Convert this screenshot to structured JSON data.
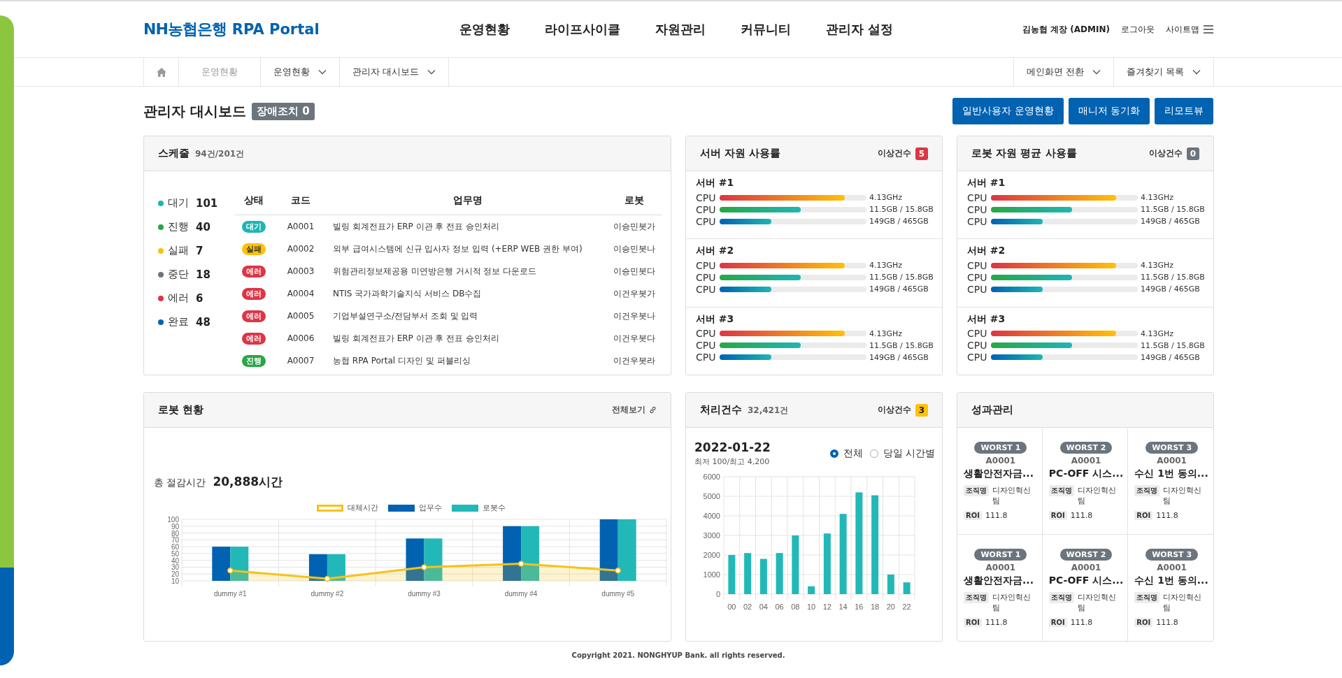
{
  "header": {
    "logo": {
      "brand": "NH농협은행",
      "product": "RPA Portal"
    },
    "menu": [
      "운영현황",
      "라이프사이클",
      "자원관리",
      "커뮤니티",
      "관리자 설정"
    ],
    "user": "김농협 계장 (ADMIN)",
    "logout": "로그아웃",
    "sitemap": "사이트맵"
  },
  "breadcrumb": {
    "current": "운영현황",
    "dropdowns": [
      "운영현황",
      "관리자 대시보드"
    ],
    "right_dropdowns": [
      "메인화면 전환",
      "즐겨찾기 목록"
    ]
  },
  "page": {
    "title": "관리자 대시보드",
    "badge": "장애조치 0",
    "buttons": [
      "일반사용자 운영현황",
      "매니저 동기화",
      "리모트뷰"
    ]
  },
  "schedule": {
    "title": "스케줄",
    "count": "94건/201건",
    "legend": [
      {
        "label": "대기",
        "count": "101",
        "color": "#1fb5b5"
      },
      {
        "label": "진행",
        "count": "40",
        "color": "#28a745"
      },
      {
        "label": "실패",
        "count": "7",
        "color": "#ffc107"
      },
      {
        "label": "중단",
        "count": "18",
        "color": "#6c757d"
      },
      {
        "label": "에러",
        "count": "6",
        "color": "#dc3545"
      },
      {
        "label": "완료",
        "count": "48",
        "color": "#0062b1"
      }
    ],
    "table": {
      "columns": [
        "상태",
        "코드",
        "업무명",
        "로봇"
      ],
      "rows": [
        {
          "status": {
            "label": "대기",
            "color": "#1fb5b5"
          },
          "code": "A0001",
          "task": "빌링 회계전표가 ERP 이관 후 전표 승인처리",
          "robot": "이승민봇가"
        },
        {
          "status": {
            "label": "실패",
            "color": "#ffc107"
          },
          "code": "A0002",
          "task": "외부 급여시스템에 신규 입사자 정보 입력 (+ERP WEB 권한 부여)",
          "robot": "이승민봇나"
        },
        {
          "status": {
            "label": "에러",
            "color": "#dc3545"
          },
          "code": "A0003",
          "task": "위험관리정보제공용 미연방은행 거시적 정보 다운로드",
          "robot": "이승민봇다"
        },
        {
          "status": {
            "label": "에러",
            "color": "#dc3545"
          },
          "code": "A0004",
          "task": "NTIS 국가과학기술지식 서비스 DB수집",
          "robot": "이건우봇가"
        },
        {
          "status": {
            "label": "에러",
            "color": "#dc3545"
          },
          "code": "A0005",
          "task": "기업부설연구소/전담부서 조회 및 입력",
          "robot": "이건우봇나"
        },
        {
          "status": {
            "label": "에러",
            "color": "#dc3545"
          },
          "code": "A0006",
          "task": "빌링 회계전표가 ERP 이관 후 전표 승인처리",
          "robot": "이건우봇다"
        },
        {
          "status": {
            "label": "진행",
            "color": "#28a745"
          },
          "code": "A0007",
          "task": "농협 RPA Portal 디자인 및 퍼블리싱",
          "robot": "이건우봇라"
        }
      ]
    }
  },
  "server_usage": {
    "title": "서버 자원 사용률",
    "alert": {
      "label": "이상건수",
      "count": "5",
      "kind": "danger"
    },
    "servers": [
      {
        "name": "서버 #1",
        "bars": [
          {
            "label": "CPU",
            "level": 0.85,
            "reading": "4.13GHz"
          },
          {
            "label": "CPU",
            "level": 0.55,
            "reading": "11.5GB / 15.8GB"
          },
          {
            "label": "CPU",
            "level": 0.35,
            "reading": "149GB / 465GB"
          }
        ]
      },
      {
        "name": "서버 #2",
        "bars": [
          {
            "label": "CPU",
            "level": 0.85,
            "reading": "4.13GHz"
          },
          {
            "label": "CPU",
            "level": 0.55,
            "reading": "11.5GB / 15.8GB"
          },
          {
            "label": "CPU",
            "level": 0.35,
            "reading": "149GB / 465GB"
          }
        ]
      },
      {
        "name": "서버 #3",
        "bars": [
          {
            "label": "CPU",
            "level": 0.85,
            "reading": "4.13GHz"
          },
          {
            "label": "CPU",
            "level": 0.55,
            "reading": "11.5GB / 15.8GB"
          },
          {
            "label": "CPU",
            "level": 0.35,
            "reading": "149GB / 465GB"
          }
        ]
      }
    ]
  },
  "robot_usage": {
    "title": "로봇 자원 평균 사용률",
    "alert": {
      "label": "이상건수",
      "count": "0",
      "kind": "neutral"
    },
    "servers": [
      {
        "name": "서버 #1",
        "bars": [
          {
            "label": "CPU",
            "level": 0.85,
            "reading": "4.13GHz"
          },
          {
            "label": "CPU",
            "level": 0.55,
            "reading": "11.5GB / 15.8GB"
          },
          {
            "label": "CPU",
            "level": 0.35,
            "reading": "149GB / 465GB"
          }
        ]
      },
      {
        "name": "서버 #2",
        "bars": [
          {
            "label": "CPU",
            "level": 0.85,
            "reading": "4.13GHz"
          },
          {
            "label": "CPU",
            "level": 0.55,
            "reading": "11.5GB / 15.8GB"
          },
          {
            "label": "CPU",
            "level": 0.35,
            "reading": "149GB / 465GB"
          }
        ]
      },
      {
        "name": "서버 #3",
        "bars": [
          {
            "label": "CPU",
            "level": 0.85,
            "reading": "4.13GHz"
          },
          {
            "label": "CPU",
            "level": 0.55,
            "reading": "11.5GB / 15.8GB"
          },
          {
            "label": "CPU",
            "level": 0.35,
            "reading": "149GB / 465GB"
          }
        ]
      }
    ]
  },
  "robot_status": {
    "title": "로봇 현황",
    "link": "전체보기",
    "total_label": "총 절감시간",
    "total_value": "20,888시간",
    "chart_data": {
      "type": "bar",
      "categories": [
        "dummy #1",
        "dummy #2",
        "dummy #3",
        "dummy #4",
        "dummy #5"
      ],
      "series": [
        {
          "name": "대체시간",
          "color": "#f5c21b",
          "type": "area",
          "marker": "circle",
          "values": [
            25,
            13,
            30,
            35,
            25
          ]
        },
        {
          "name": "업무수",
          "color": "#0062b1",
          "type": "bar",
          "values": [
            60,
            49,
            72,
            90,
            100
          ]
        },
        {
          "name": "로봇수",
          "color": "#22b8b8",
          "type": "bar",
          "values": [
            60,
            49,
            72,
            90,
            100
          ]
        }
      ],
      "stacked": false,
      "grid": true,
      "legend": "top",
      "ylim": [
        10,
        100
      ],
      "yticks": [
        10,
        20,
        30,
        40,
        50,
        60,
        70,
        80,
        90,
        100
      ]
    }
  },
  "processing": {
    "title": "처리건수",
    "count": "32,421건",
    "alert": {
      "label": "이상건수",
      "count": "3",
      "kind": "warning"
    },
    "date": "2022-01-22",
    "range": "최저 100/최고 4,200",
    "radios": [
      {
        "label": "전체",
        "selected": true
      },
      {
        "label": "당일 시간별",
        "selected": false
      }
    ],
    "chart_data": {
      "type": "bar",
      "categories": [
        "00",
        "02",
        "04",
        "06",
        "08",
        "10",
        "12",
        "14",
        "16",
        "18",
        "20",
        "22"
      ],
      "values": [
        2000,
        2100,
        1800,
        2100,
        3000,
        400,
        3100,
        4100,
        5200,
        5050,
        1000,
        600
      ],
      "grid": true,
      "ylim": [
        0,
        6000
      ],
      "yticks": [
        0,
        1000,
        2000,
        3000,
        4000,
        5000,
        6000
      ]
    }
  },
  "performance": {
    "title": "성과관리",
    "cards": [
      {
        "rank": "WORST 1",
        "code": "A0001",
        "name": "생활안전자금...",
        "org_label": "조직명",
        "org": "디자인혁신팀",
        "roi_label": "ROI",
        "roi": "111.8"
      },
      {
        "rank": "WORST 2",
        "code": "A0001",
        "name": "PC-OFF 시스...",
        "org_label": "조직명",
        "org": "디자인혁신팀",
        "roi_label": "ROI",
        "roi": "111.8"
      },
      {
        "rank": "WORST 3",
        "code": "A0001",
        "name": "수신 1번 동의...",
        "org_label": "조직명",
        "org": "디자인혁신팀",
        "roi_label": "ROI",
        "roi": "111.8"
      },
      {
        "rank": "WORST 1",
        "code": "A0001",
        "name": "생활안전자금...",
        "org_label": "조직명",
        "org": "디자인혁신팀",
        "roi_label": "ROI",
        "roi": "111.8"
      },
      {
        "rank": "WORST 2",
        "code": "A0001",
        "name": "PC-OFF 시스...",
        "org_label": "조직명",
        "org": "디자인혁신팀",
        "roi_label": "ROI",
        "roi": "111.8"
      },
      {
        "rank": "WORST 3",
        "code": "A0001",
        "name": "수신 1번 동의...",
        "org_label": "조직명",
        "org": "디자인혁신팀",
        "roi_label": "ROI",
        "roi": "111.8"
      }
    ]
  },
  "footer": "Copyright 2021. NONGHYUP Bank. all rights reserved."
}
